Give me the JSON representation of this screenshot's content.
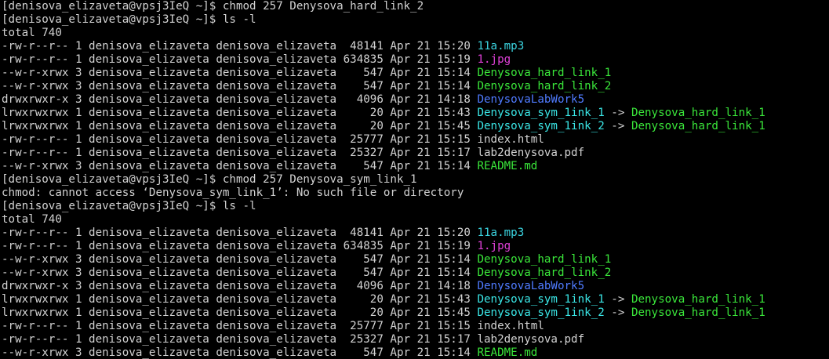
{
  "window": {
    "background": "#000000"
  },
  "colors": {
    "default_text": "#d2d2d2",
    "audio_file": "#3bd4e0",
    "image_file": "#e040d8",
    "executable": "#3ae63a",
    "directory": "#4f7bff",
    "symlink": "#3ae6e6"
  },
  "lines": [
    {
      "segments": [
        {
          "text": "[denisova_elizaveta@vpsj3IeQ ~]$ chmod 257 Denysova_hard_link_2",
          "color": "#d2d2d2"
        }
      ]
    },
    {
      "segments": [
        {
          "text": "[denisova_elizaveta@vpsj3IeQ ~]$ ls -l",
          "color": "#d2d2d2"
        }
      ]
    },
    {
      "segments": [
        {
          "text": "total 740",
          "color": "#d2d2d2"
        }
      ]
    },
    {
      "segments": [
        {
          "text": "-rw-r--r-- 1 denisova_elizaveta denisova_elizaveta  48141 Apr 21 15:20 ",
          "color": "#d2d2d2"
        },
        {
          "text": "11a.mp3",
          "color": "#3bd4e0"
        }
      ]
    },
    {
      "segments": [
        {
          "text": "-rw-r--r-- 1 denisova_elizaveta denisova_elizaveta 634835 Apr 21 15:19 ",
          "color": "#d2d2d2"
        },
        {
          "text": "1.jpg",
          "color": "#e040d8"
        }
      ]
    },
    {
      "segments": [
        {
          "text": "--w-r-xrwx 3 denisova_elizaveta denisova_elizaveta    547 Apr 21 15:14 ",
          "color": "#d2d2d2"
        },
        {
          "text": "Denysova_hard_link_1",
          "color": "#3ae63a"
        }
      ]
    },
    {
      "segments": [
        {
          "text": "--w-r-xrwx 3 denisova_elizaveta denisova_elizaveta    547 Apr 21 15:14 ",
          "color": "#d2d2d2"
        },
        {
          "text": "Denysova_hard_link_2",
          "color": "#3ae63a"
        }
      ]
    },
    {
      "segments": [
        {
          "text": "drwxrwxr-x 3 denisova_elizaveta denisova_elizaveta   4096 Apr 21 14:18 ",
          "color": "#d2d2d2"
        },
        {
          "text": "DenysovaLabWork5",
          "color": "#4f7bff"
        }
      ]
    },
    {
      "segments": [
        {
          "text": "lrwxrwxrwx 1 denisova_elizaveta denisova_elizaveta     20 Apr 21 15:43 ",
          "color": "#d2d2d2"
        },
        {
          "text": "Denysova_sym_1ink_1",
          "color": "#3ae6e6"
        },
        {
          "text": " -> ",
          "color": "#d2d2d2"
        },
        {
          "text": "Denysova_hard_link_1",
          "color": "#3ae63a"
        }
      ]
    },
    {
      "segments": [
        {
          "text": "lrwxrwxrwx 1 denisova_elizaveta denisova_elizaveta     20 Apr 21 15:45 ",
          "color": "#d2d2d2"
        },
        {
          "text": "Denysova_sym_1ink_2",
          "color": "#3ae6e6"
        },
        {
          "text": " -> ",
          "color": "#d2d2d2"
        },
        {
          "text": "Denysova_hard_link_1",
          "color": "#3ae63a"
        }
      ]
    },
    {
      "segments": [
        {
          "text": "-rw-r--r-- 1 denisova_elizaveta denisova_elizaveta  25777 Apr 21 15:15 index.html",
          "color": "#d2d2d2"
        }
      ]
    },
    {
      "segments": [
        {
          "text": "-rw-r--r-- 1 denisova_elizaveta denisova_elizaveta  25327 Apr 21 15:17 lab2denysova.pdf",
          "color": "#d2d2d2"
        }
      ]
    },
    {
      "segments": [
        {
          "text": "--w-r-xrwx 3 denisova_elizaveta denisova_elizaveta    547 Apr 21 15:14 ",
          "color": "#d2d2d2"
        },
        {
          "text": "README.md",
          "color": "#3ae63a"
        }
      ]
    },
    {
      "segments": [
        {
          "text": "[denisova_elizaveta@vpsj3IeQ ~]$ chmod 257 Denysova_sym_link_1",
          "color": "#d2d2d2"
        }
      ]
    },
    {
      "segments": [
        {
          "text": "chmod: cannot access ‘Denysova_sym_link_1’: No such file or directory",
          "color": "#d2d2d2"
        }
      ]
    },
    {
      "segments": [
        {
          "text": "[denisova_elizaveta@vpsj3IeQ ~]$ ls -l",
          "color": "#d2d2d2"
        }
      ]
    },
    {
      "segments": [
        {
          "text": "total 740",
          "color": "#d2d2d2"
        }
      ]
    },
    {
      "segments": [
        {
          "text": "-rw-r--r-- 1 denisova_elizaveta denisova_elizaveta  48141 Apr 21 15:20 ",
          "color": "#d2d2d2"
        },
        {
          "text": "11a.mp3",
          "color": "#3bd4e0"
        }
      ]
    },
    {
      "segments": [
        {
          "text": "-rw-r--r-- 1 denisova_elizaveta denisova_elizaveta 634835 Apr 21 15:19 ",
          "color": "#d2d2d2"
        },
        {
          "text": "1.jpg",
          "color": "#e040d8"
        }
      ]
    },
    {
      "segments": [
        {
          "text": "--w-r-xrwx 3 denisova_elizaveta denisova_elizaveta    547 Apr 21 15:14 ",
          "color": "#d2d2d2"
        },
        {
          "text": "Denysova_hard_link_1",
          "color": "#3ae63a"
        }
      ]
    },
    {
      "segments": [
        {
          "text": "--w-r-xrwx 3 denisova_elizaveta denisova_elizaveta    547 Apr 21 15:14 ",
          "color": "#d2d2d2"
        },
        {
          "text": "Denysova_hard_link_2",
          "color": "#3ae63a"
        }
      ]
    },
    {
      "segments": [
        {
          "text": "drwxrwxr-x 3 denisova_elizaveta denisova_elizaveta   4096 Apr 21 14:18 ",
          "color": "#d2d2d2"
        },
        {
          "text": "DenysovaLabWork5",
          "color": "#4f7bff"
        }
      ]
    },
    {
      "segments": [
        {
          "text": "lrwxrwxrwx 1 denisova_elizaveta denisova_elizaveta     20 Apr 21 15:43 ",
          "color": "#d2d2d2"
        },
        {
          "text": "Denysova_sym_1ink_1",
          "color": "#3ae6e6"
        },
        {
          "text": " -> ",
          "color": "#d2d2d2"
        },
        {
          "text": "Denysova_hard_link_1",
          "color": "#3ae63a"
        }
      ]
    },
    {
      "segments": [
        {
          "text": "lrwxrwxrwx 1 denisova_elizaveta denisova_elizaveta     20 Apr 21 15:45 ",
          "color": "#d2d2d2"
        },
        {
          "text": "Denysova_sym_1ink_2",
          "color": "#3ae6e6"
        },
        {
          "text": " -> ",
          "color": "#d2d2d2"
        },
        {
          "text": "Denysova_hard_link_1",
          "color": "#3ae63a"
        }
      ]
    },
    {
      "segments": [
        {
          "text": "-rw-r--r-- 1 denisova_elizaveta denisova_elizaveta  25777 Apr 21 15:15 index.html",
          "color": "#d2d2d2"
        }
      ]
    },
    {
      "segments": [
        {
          "text": "-rw-r--r-- 1 denisova_elizaveta denisova_elizaveta  25327 Apr 21 15:17 lab2denysova.pdf",
          "color": "#d2d2d2"
        }
      ]
    },
    {
      "segments": [
        {
          "text": "--w-r-xrwx 3 denisova_elizaveta denisova_elizaveta    547 Apr 21 15:14 ",
          "color": "#d2d2d2"
        },
        {
          "text": "README.md",
          "color": "#3ae63a"
        }
      ]
    }
  ]
}
